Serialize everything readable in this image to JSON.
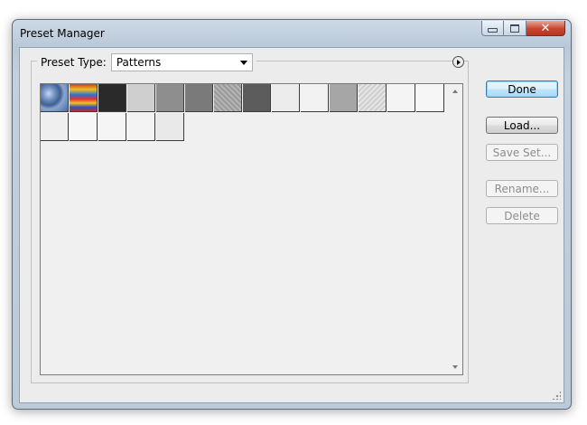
{
  "window": {
    "title": "Preset Manager",
    "caption": {
      "minimize_icon": "minimize-icon",
      "maximize_icon": "maximize-icon",
      "close_glyph": "✕"
    }
  },
  "preset_type": {
    "label": "Preset Type:",
    "selected": "Patterns",
    "menu_icon": "flyout-menu-icon"
  },
  "patterns": [
    {
      "icon": "blue-bubbles-pattern",
      "fill": "radial-gradient(circle at 30% 35%,#c8d8f0 0,#6e8fbf 25%,#3f5f8f 45%,#8aa6d2 60%,#4a6a9c 100%)"
    },
    {
      "icon": "tie-dye-pattern",
      "fill": "linear-gradient(180deg,#d04020 0,#e8c020 20%,#3070d0 40%,#e83030 55%,#f0c020 70%,#3050c0 85%,#c03020 100%)"
    },
    {
      "icon": "dark-texture-pattern",
      "fill": "#2a2a2a"
    },
    {
      "icon": "light-gray-pattern",
      "fill": "#cfcfcf"
    },
    {
      "icon": "medium-gray-pattern",
      "fill": "#8e8e8e"
    },
    {
      "icon": "gray-pattern",
      "fill": "#7a7a7a"
    },
    {
      "icon": "noise-gray-pattern",
      "fill": "repeating-linear-gradient(45deg,#9a9a9a 0,#bcbcbc 2px,#8a8a8a 4px)"
    },
    {
      "icon": "charcoal-pattern",
      "fill": "#5c5c5c"
    },
    {
      "icon": "white-paper-pattern",
      "fill": "#ececec"
    },
    {
      "icon": "white-pattern",
      "fill": "#f2f2f2"
    },
    {
      "icon": "silver-pattern",
      "fill": "#a6a6a6"
    },
    {
      "icon": "crumpled-paper-pattern",
      "fill": "repeating-linear-gradient(135deg,#e6e6e6 0,#c8c8c8 2px,#f2f2f2 4px)"
    },
    {
      "icon": "white-pattern-2",
      "fill": "#f4f4f4"
    },
    {
      "icon": "white-pattern-3",
      "fill": "#f6f6f6"
    },
    {
      "icon": "faint-white-pattern",
      "fill": "#efefef"
    },
    {
      "icon": "white-pattern-4",
      "fill": "#f7f7f7"
    },
    {
      "icon": "white-pattern-5",
      "fill": "#f5f5f5"
    },
    {
      "icon": "white-pattern-6",
      "fill": "#f3f3f3"
    },
    {
      "icon": "pale-gray-pattern",
      "fill": "#e9e9e9"
    }
  ],
  "buttons": {
    "done": "Done",
    "load": "Load...",
    "save_set": "Save Set...",
    "rename": "Rename...",
    "delete": "Delete"
  }
}
